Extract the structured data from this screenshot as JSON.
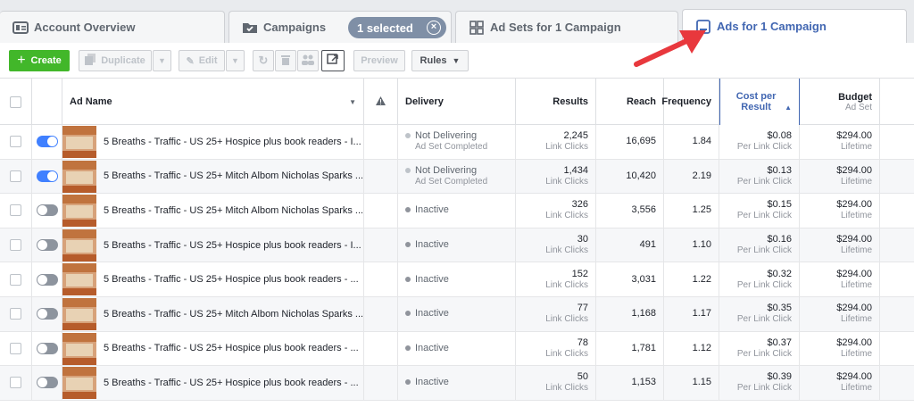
{
  "tabs": [
    {
      "label": "Account Overview",
      "icon": "account-overview-icon"
    },
    {
      "label": "Campaigns",
      "icon": "folder-check-icon"
    },
    {
      "label": "Ad Sets for 1 Campaign",
      "icon": "grid-icon"
    },
    {
      "label": "Ads for 1 Campaign",
      "icon": "ad-icon"
    }
  ],
  "selection_pill": {
    "label": "1 selected"
  },
  "toolbar": {
    "create_label": "Create",
    "duplicate_label": "Duplicate",
    "edit_label": "Edit",
    "preview_label": "Preview",
    "rules_label": "Rules"
  },
  "colors": {
    "accent": "#4267b2",
    "create_green": "#42b72a",
    "toggle_on": "#4080ff",
    "arrow_red": "#e8383d"
  },
  "columns": {
    "ad_name": "Ad Name",
    "delivery": "Delivery",
    "results": "Results",
    "reach": "Reach",
    "frequency": "Frequency",
    "cost_per_result": "Cost per Result",
    "budget": "Budget",
    "budget_sub": "Ad Set"
  },
  "rows": [
    {
      "on": true,
      "name": "5 Breaths - Traffic - US 25+ Hospice plus book readers - I...",
      "delivery": "Not Delivering",
      "delivery_sub": "Ad Set Completed",
      "results": "2,245",
      "results_sub": "Link Clicks",
      "reach": "16,695",
      "frequency": "1.84",
      "cost": "$0.08",
      "cost_sub": "Per Link Click",
      "budget": "$294.00",
      "budget_sub": "Lifetime"
    },
    {
      "on": true,
      "name": "5 Breaths - Traffic - US 25+ Mitch Albom Nicholas Sparks ...",
      "delivery": "Not Delivering",
      "delivery_sub": "Ad Set Completed",
      "results": "1,434",
      "results_sub": "Link Clicks",
      "reach": "10,420",
      "frequency": "2.19",
      "cost": "$0.13",
      "cost_sub": "Per Link Click",
      "budget": "$294.00",
      "budget_sub": "Lifetime"
    },
    {
      "on": false,
      "name": "5 Breaths - Traffic - US 25+ Mitch Albom Nicholas Sparks ...",
      "delivery": "Inactive",
      "delivery_sub": "",
      "results": "326",
      "results_sub": "Link Clicks",
      "reach": "3,556",
      "frequency": "1.25",
      "cost": "$0.15",
      "cost_sub": "Per Link Click",
      "budget": "$294.00",
      "budget_sub": "Lifetime"
    },
    {
      "on": false,
      "name": "5 Breaths - Traffic - US 25+ Hospice plus book readers - I...",
      "delivery": "Inactive",
      "delivery_sub": "",
      "results": "30",
      "results_sub": "Link Clicks",
      "reach": "491",
      "frequency": "1.10",
      "cost": "$0.16",
      "cost_sub": "Per Link Click",
      "budget": "$294.00",
      "budget_sub": "Lifetime"
    },
    {
      "on": false,
      "name": "5 Breaths - Traffic - US 25+ Hospice plus book readers - ...",
      "delivery": "Inactive",
      "delivery_sub": "",
      "results": "152",
      "results_sub": "Link Clicks",
      "reach": "3,031",
      "frequency": "1.22",
      "cost": "$0.32",
      "cost_sub": "Per Link Click",
      "budget": "$294.00",
      "budget_sub": "Lifetime"
    },
    {
      "on": false,
      "name": "5 Breaths - Traffic - US 25+ Mitch Albom Nicholas Sparks ...",
      "delivery": "Inactive",
      "delivery_sub": "",
      "results": "77",
      "results_sub": "Link Clicks",
      "reach": "1,168",
      "frequency": "1.17",
      "cost": "$0.35",
      "cost_sub": "Per Link Click",
      "budget": "$294.00",
      "budget_sub": "Lifetime"
    },
    {
      "on": false,
      "name": "5 Breaths - Traffic - US 25+ Hospice plus book readers - ...",
      "delivery": "Inactive",
      "delivery_sub": "",
      "results": "78",
      "results_sub": "Link Clicks",
      "reach": "1,781",
      "frequency": "1.12",
      "cost": "$0.37",
      "cost_sub": "Per Link Click",
      "budget": "$294.00",
      "budget_sub": "Lifetime"
    },
    {
      "on": false,
      "name": "5 Breaths - Traffic - US 25+ Hospice plus book readers - ...",
      "delivery": "Inactive",
      "delivery_sub": "",
      "results": "50",
      "results_sub": "Link Clicks",
      "reach": "1,153",
      "frequency": "1.15",
      "cost": "$0.39",
      "cost_sub": "Per Link Click",
      "budget": "$294.00",
      "budget_sub": "Lifetime"
    }
  ]
}
